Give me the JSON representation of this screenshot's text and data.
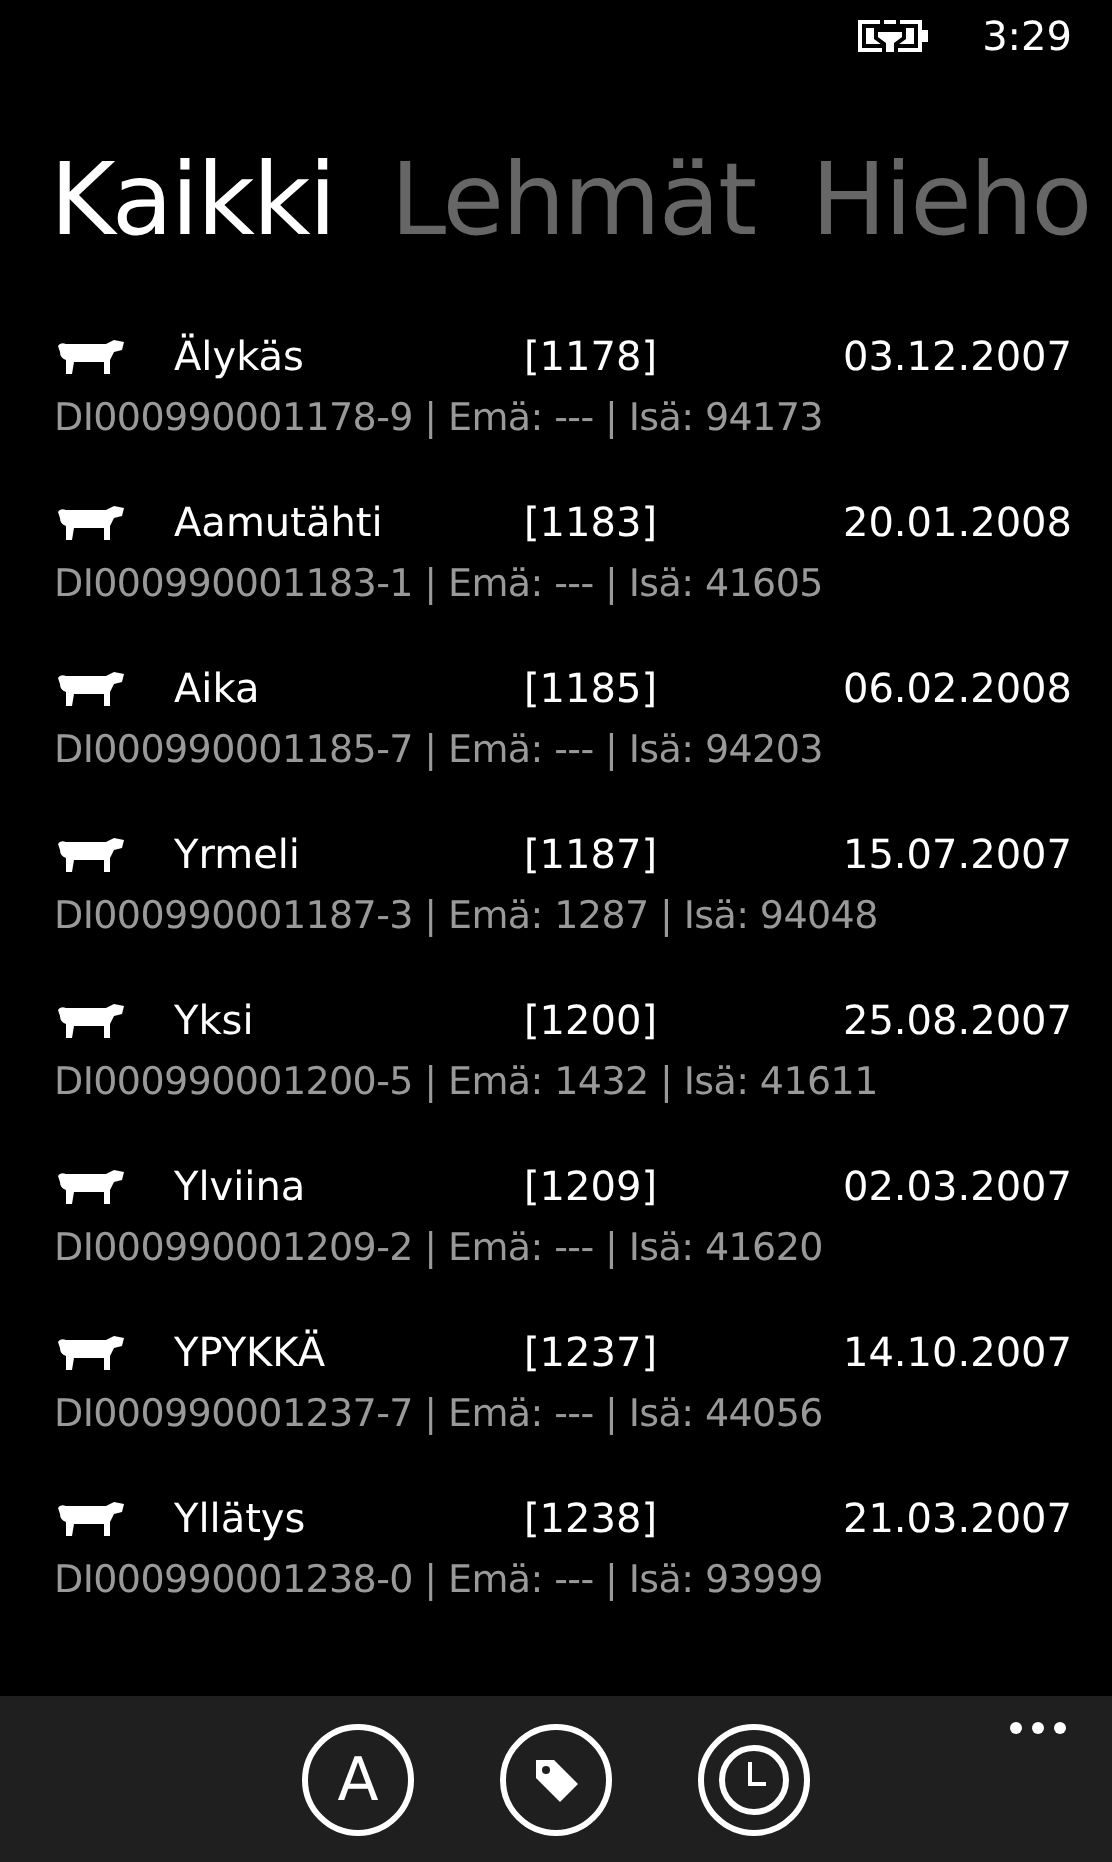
{
  "status_bar": {
    "time": "3:29"
  },
  "pivot": [
    {
      "label": "Kaikki",
      "selected": true
    },
    {
      "label": "Lehmät",
      "selected": false
    },
    {
      "label": "Hieho",
      "selected": false
    }
  ],
  "animals": [
    {
      "name": "Älykäs",
      "number": "[1178]",
      "date": "03.12.2007",
      "details": "DI000990001178-9 | Emä: --- | Isä: 94173"
    },
    {
      "name": "Aamutähti",
      "number": "[1183]",
      "date": "20.01.2008",
      "details": "DI000990001183-1 | Emä: --- | Isä: 41605"
    },
    {
      "name": "Aika",
      "number": "[1185]",
      "date": "06.02.2008",
      "details": "DI000990001185-7 | Emä: --- | Isä: 94203"
    },
    {
      "name": "Yrmeli",
      "number": "[1187]",
      "date": "15.07.2007",
      "details": "DI000990001187-3 | Emä: 1287 | Isä: 94048"
    },
    {
      "name": "Yksi",
      "number": "[1200]",
      "date": "25.08.2007",
      "details": "DI000990001200-5 | Emä: 1432 | Isä: 41611"
    },
    {
      "name": "Ylviina",
      "number": "[1209]",
      "date": "02.03.2007",
      "details": "DI000990001209-2 | Emä: --- | Isä: 41620"
    },
    {
      "name": "YPYKKÄ",
      "number": "[1237]",
      "date": "14.10.2007",
      "details": "DI000990001237-7 | Emä: --- | Isä: 44056"
    },
    {
      "name": "Yllätys",
      "number": "[1238]",
      "date": "21.03.2007",
      "details": "DI000990001238-0 | Emä: --- | Isä: 93999"
    }
  ],
  "app_bar": {
    "buttons": [
      {
        "kind": "letter",
        "label": "A"
      },
      {
        "kind": "tag"
      },
      {
        "kind": "clock"
      }
    ]
  }
}
